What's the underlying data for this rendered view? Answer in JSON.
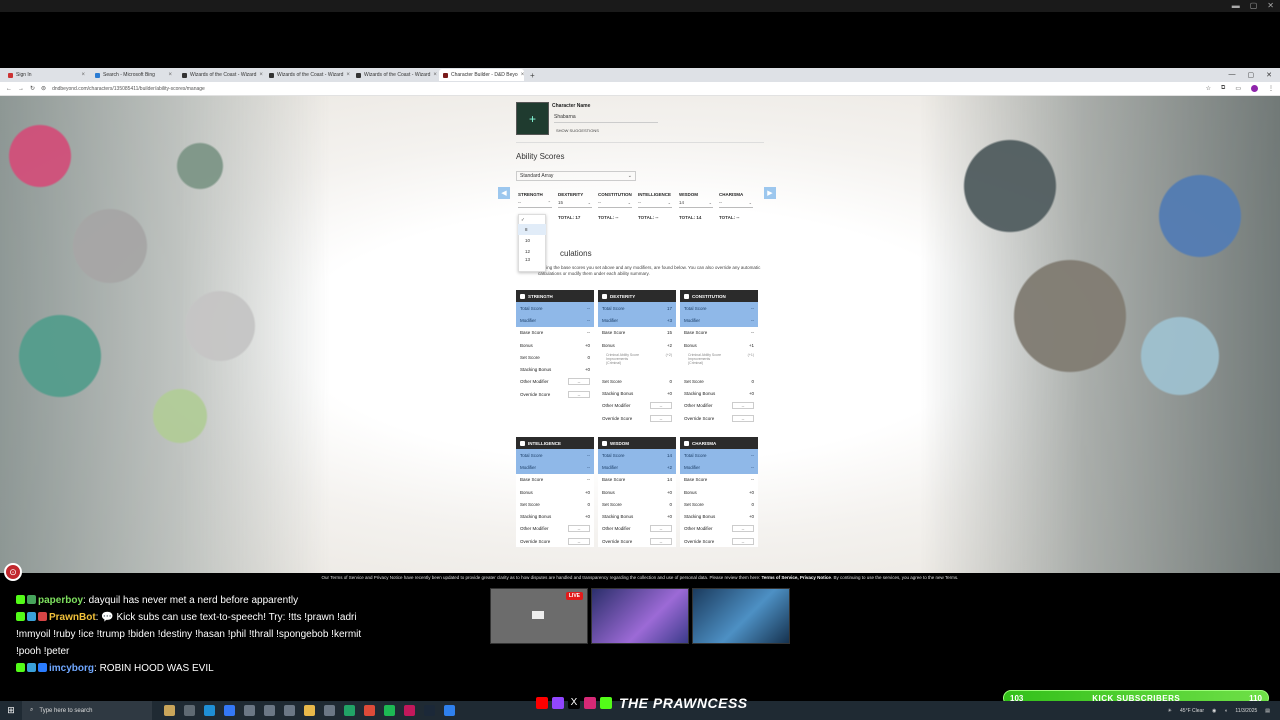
{
  "browser": {
    "tabs": [
      {
        "label": "Sign In"
      },
      {
        "label": "Search - Microsoft Bing"
      },
      {
        "label": "Wizards of the Coast - Wizard"
      },
      {
        "label": "Wizards of the Coast - Wizard"
      },
      {
        "label": "Wizards of the Coast - Wizard"
      },
      {
        "label": "Character Builder - D&D Beyo"
      }
    ],
    "url": "dndbeyond.com/characters/135085411/builder/ability-scores/manage"
  },
  "builder": {
    "character_name_label": "Character Name",
    "character_name": "Shabarna",
    "suggestions": "SHOW SUGGESTIONS",
    "ability_scores_title": "Ability Scores",
    "method": "Standard Array",
    "abilities": [
      {
        "name": "STRENGTH",
        "value": "--",
        "total": ""
      },
      {
        "name": "DEXTERITY",
        "value": "15",
        "total": "TOTAL: 17"
      },
      {
        "name": "CONSTITUTION",
        "value": "--",
        "total": "TOTAL: --"
      },
      {
        "name": "INTELLIGENCE",
        "value": "--",
        "total": "TOTAL: --"
      },
      {
        "name": "WISDOM",
        "value": "14",
        "total": "TOTAL: 14"
      },
      {
        "name": "CHARISMA",
        "value": "--",
        "total": "TOTAL: --"
      }
    ],
    "dropdown_options": [
      "8",
      "10",
      "12",
      "13"
    ],
    "calc_title": "culations",
    "calc_desc": "cluding the base scores you set above and any modifiers, are found below. You can also override any automatic calculations or modify them under each ability summary.",
    "cards": {
      "str": {
        "title": "STRENGTH",
        "total": "--",
        "modifier": "--",
        "base": "--",
        "bonus": "+0",
        "set": "0",
        "stacking": "+0"
      },
      "dex": {
        "title": "DEXTERITY",
        "total": "17",
        "modifier": "+3",
        "base": "15",
        "bonus": "+2",
        "note": "Criminal Ability Score Improvements (Criminal)",
        "note_val": "(+2)",
        "set": "0",
        "stacking": "+0"
      },
      "con": {
        "title": "CONSTITUTION",
        "total": "--",
        "modifier": "--",
        "base": "--",
        "bonus": "+1",
        "note": "Criminal Ability Score Improvements (Criminal)",
        "note_val": "(+1)",
        "set": "0",
        "stacking": "+0"
      },
      "int": {
        "title": "INTELLIGENCE",
        "total": "--",
        "modifier": "--",
        "base": "--",
        "bonus": "+0",
        "set": "0",
        "stacking": "+0"
      },
      "wis": {
        "title": "WISDOM",
        "total": "14",
        "modifier": "+2",
        "base": "14",
        "bonus": "+0",
        "set": "0",
        "stacking": "+0"
      },
      "cha": {
        "title": "CHARISMA",
        "total": "--",
        "modifier": "--",
        "base": "--",
        "bonus": "+0",
        "set": "0",
        "stacking": "+0"
      }
    },
    "labels": {
      "total": "Total Score",
      "modifier": "Modifier",
      "base": "Base Score",
      "bonus": "Bonus",
      "set": "Set Score",
      "stacking": "Stacking Bonus",
      "other": "Other Modifier",
      "override": "Override Score"
    }
  },
  "notice": {
    "text": "Our Terms of Service and Privacy Notice have recently been updated to provide greater clarity as to how disputes are handled and transparency regarding the collection and use of personal data. Please review them here:",
    "links": "Terms of Service, Privacy Notice",
    "tail": ". By continuing to use the services, you agree to the new Terms."
  },
  "chat": [
    {
      "user": "paperboy",
      "text": ": dayquil has never met a nerd before apparently",
      "color": "#7ee05e"
    },
    {
      "user": "PrawnBot",
      "text": ": 💬 Kick subs can use text-to-speech! Try: !tts !prawn !adri !mmyoil !ruby !ice !trump !biden !destiny !hasan !phil !thrall !spongebob !kermit !pooh !peter",
      "color": "#f2c13a"
    },
    {
      "user": "imcyborg",
      "text": ": ROBIN HOOD WAS EVIL",
      "color": "#6fa7ff"
    }
  ],
  "stream": {
    "live": "LIVE",
    "subs_count": "103",
    "subs_label": "KICK SUBSCRIBERS",
    "subs_goal": "110",
    "brand": "THE PRAWNCESS"
  },
  "taskbar": {
    "search_placeholder": "Type here to search",
    "weather": "45°F Clear",
    "date": "11/3/2025"
  }
}
